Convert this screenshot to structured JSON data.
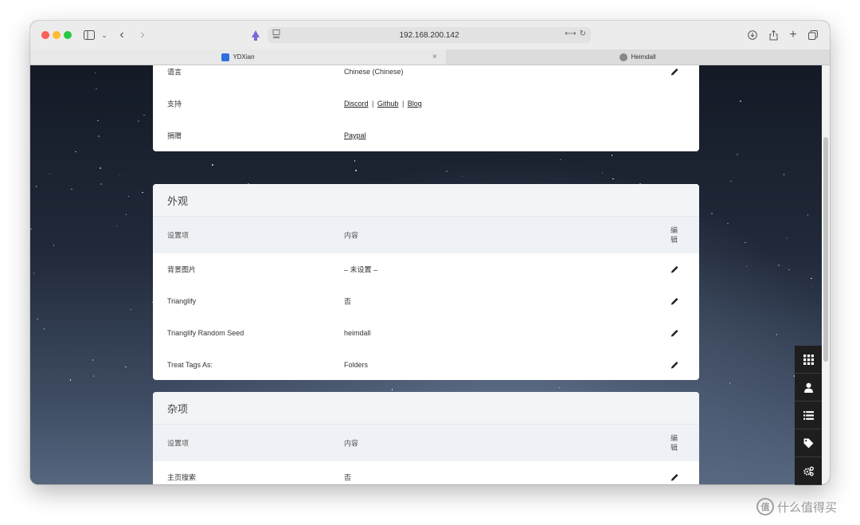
{
  "browser": {
    "address": "192.168.200.142",
    "tabs": [
      {
        "label": "YDXian",
        "active": true,
        "favicon_color": "#2f6fe0"
      },
      {
        "label": "Heimdall",
        "active": false,
        "favicon_color": "#888888"
      }
    ]
  },
  "about_card": {
    "rows": [
      {
        "label": "语言",
        "value": "Chinese (Chinese)",
        "editable": true
      },
      {
        "label": "支持",
        "links": [
          "Discord",
          "Github",
          "Blog"
        ],
        "separator": "|",
        "editable": false
      },
      {
        "label": "捐赠",
        "links": [
          "Paypal"
        ],
        "editable": false
      }
    ]
  },
  "appearance_card": {
    "title": "外观",
    "headers": {
      "setting": "设置项",
      "content": "内容",
      "edit": "编\n辑"
    },
    "rows": [
      {
        "label": "背景图片",
        "value": "– 未设置 –"
      },
      {
        "label": "Trianglify",
        "value": "否"
      },
      {
        "label": "Trianglify Random Seed",
        "value": "heimdall"
      },
      {
        "label": "Treat Tags As:",
        "value": "Folders"
      }
    ]
  },
  "misc_card": {
    "title": "杂项",
    "headers": {
      "setting": "设置项",
      "content": "内容",
      "edit": "编\n辑"
    },
    "rows": [
      {
        "label": "主页搜索",
        "value": "否"
      }
    ]
  },
  "sidebar": {
    "items": [
      "grid-icon",
      "user-icon",
      "list-icon",
      "tag-icon",
      "settings-icon"
    ]
  },
  "watermark": {
    "text": "什么值得买",
    "badge": "值"
  }
}
